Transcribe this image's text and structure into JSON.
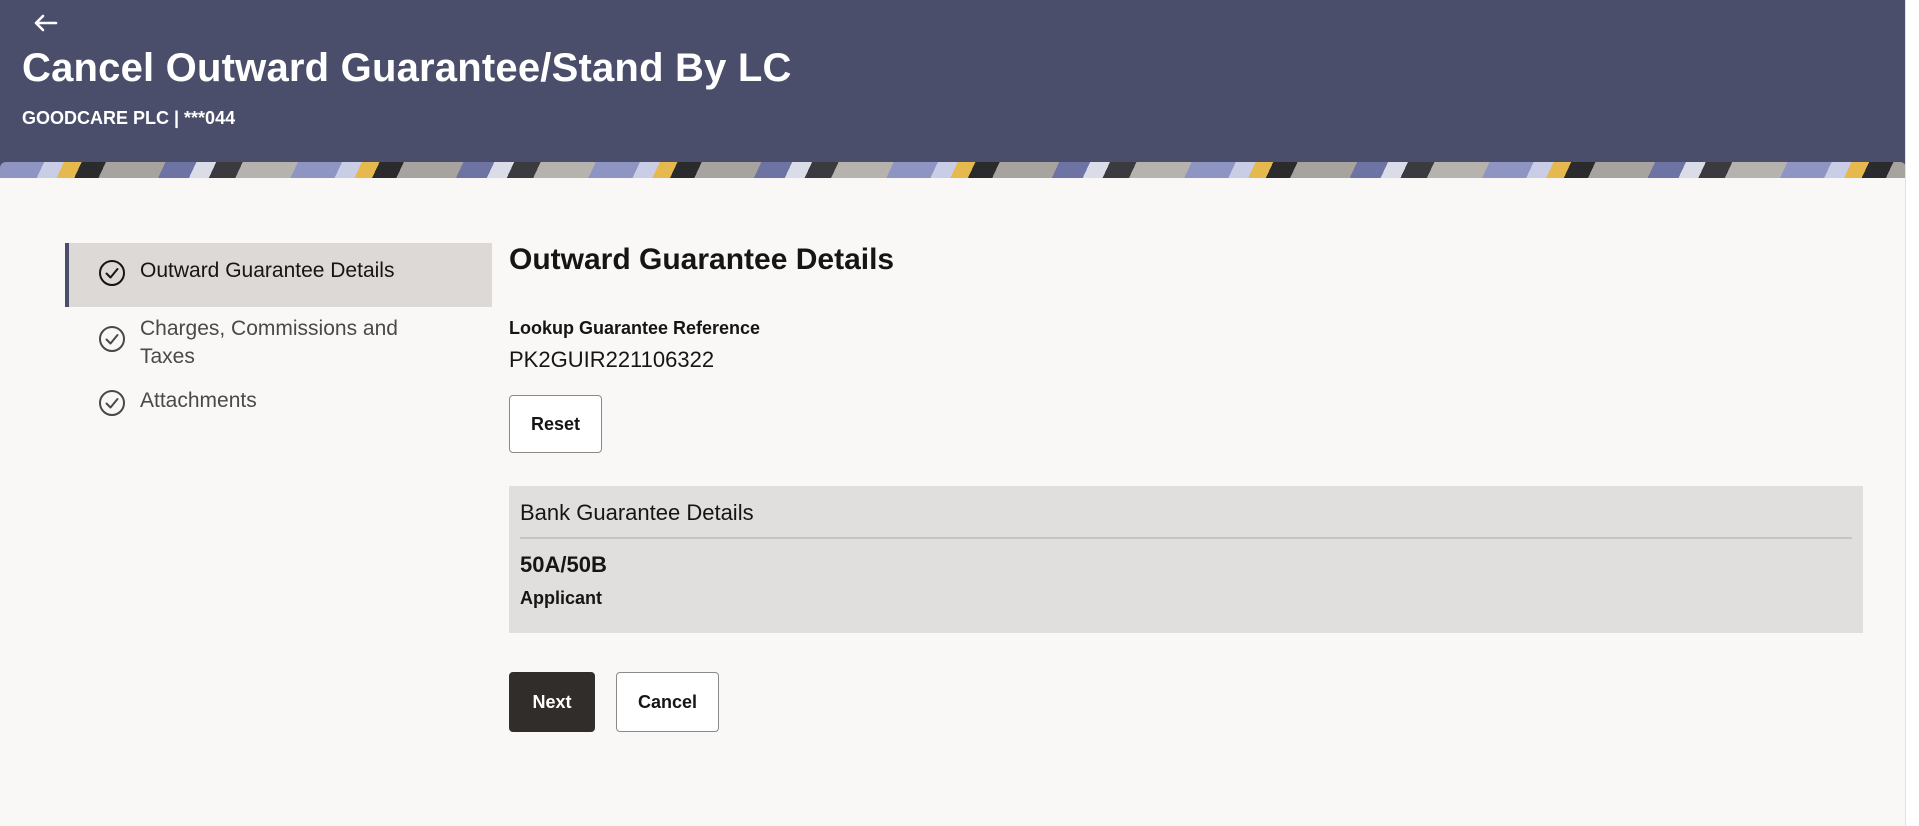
{
  "header": {
    "back_icon": "arrow-left-icon",
    "title": "Cancel Outward Guarantee/Stand By LC",
    "subtitle": "GOODCARE PLC | ***044"
  },
  "stepper": {
    "steps": [
      {
        "label": "Outward Guarantee Details",
        "icon": "check-circle-icon",
        "active": true
      },
      {
        "label_line1": "Charges, Commissions and",
        "label_line2": "Taxes",
        "icon": "check-circle-icon",
        "active": false
      },
      {
        "label": "Attachments",
        "icon": "check-circle-icon",
        "active": false
      }
    ]
  },
  "main": {
    "section_title": "Outward Guarantee Details",
    "lookup_label": "Lookup Guarantee Reference",
    "lookup_value": "PK2GUIR221106322",
    "reset_label": "Reset",
    "panel": {
      "title": "Bank Guarantee Details",
      "code": "50A/50B",
      "role": "Applicant"
    },
    "next_label": "Next",
    "cancel_label": "Cancel"
  },
  "colors": {
    "header_bg": "#4a4e6b",
    "page_bg": "#f9f8f6",
    "active_step_bg": "#dcd9d6",
    "panel_bg": "#e0dfdd",
    "primary_button": "#312d2a"
  }
}
